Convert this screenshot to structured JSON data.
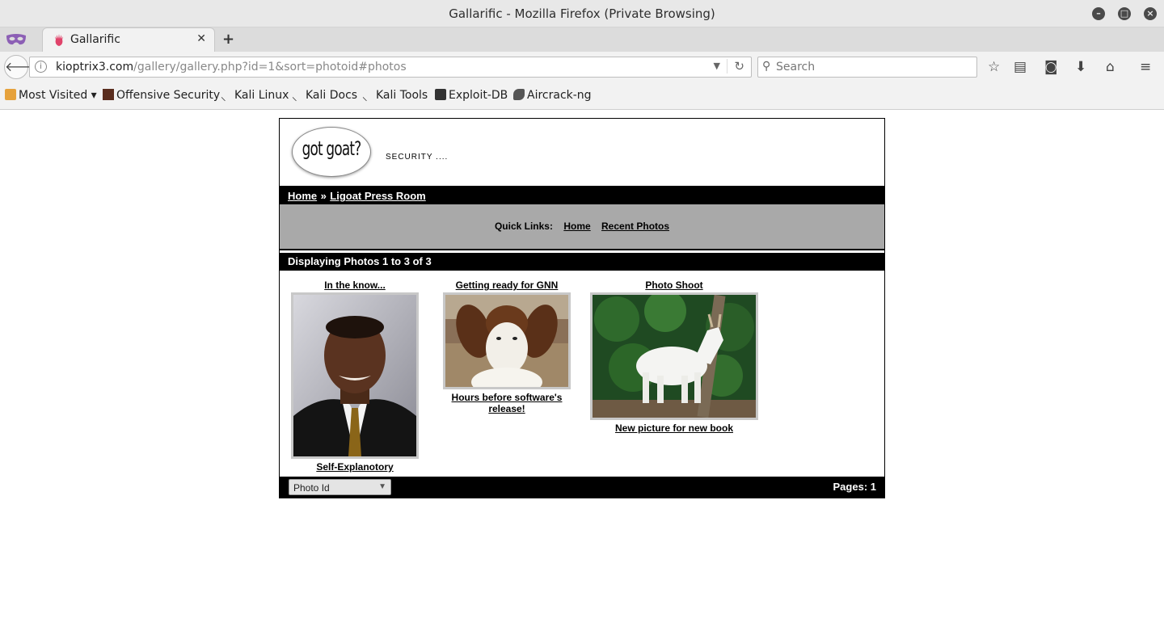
{
  "window": {
    "title": "Gallarific - Mozilla Firefox (Private Browsing)",
    "minimize_icon": "minimize-icon",
    "maximize_icon": "maximize-icon",
    "close_icon": "close-icon"
  },
  "tabs": [
    {
      "title": "Gallarific",
      "favicon": "gallarific-hand-icon",
      "active": true
    }
  ],
  "navbar": {
    "url_host": "kioptrix3.com",
    "url_path": "/gallery/gallery.php?id=1&sort=photoid#photos",
    "search_placeholder": "Search"
  },
  "bookmarks": [
    {
      "label": "Most Visited ▾",
      "icon": "most-visited-icon"
    },
    {
      "label": "Offensive Security",
      "icon": "offensive-security-icon"
    },
    {
      "label": "Kali Linux",
      "icon": "kali-dragon-icon"
    },
    {
      "label": "Kali Docs",
      "icon": "kali-dragon-icon"
    },
    {
      "label": "Kali Tools",
      "icon": "kali-dragon-icon"
    },
    {
      "label": "Exploit-DB",
      "icon": "exploit-db-icon"
    },
    {
      "label": "Aircrack-ng",
      "icon": "aircrack-ng-icon"
    }
  ],
  "page": {
    "logo_text": "got goat?",
    "tagline": "SECURITY ....",
    "breadcrumb": {
      "home": "Home",
      "separator": "»",
      "current": "Ligoat Press Room"
    },
    "quick_links": {
      "label": "Quick Links:",
      "home": "Home",
      "recent": "Recent Photos"
    },
    "display_text": "Displaying Photos 1 to 3 of 3",
    "photos": [
      {
        "title": "In the know...",
        "caption": "Self-Explanotory"
      },
      {
        "title": "Getting ready for GNN",
        "caption": "Hours before software's release!"
      },
      {
        "title": "Photo Shoot",
        "caption": "New picture for new book"
      }
    ],
    "sort_selected": "Photo Id",
    "pages_text": "Pages: 1"
  }
}
